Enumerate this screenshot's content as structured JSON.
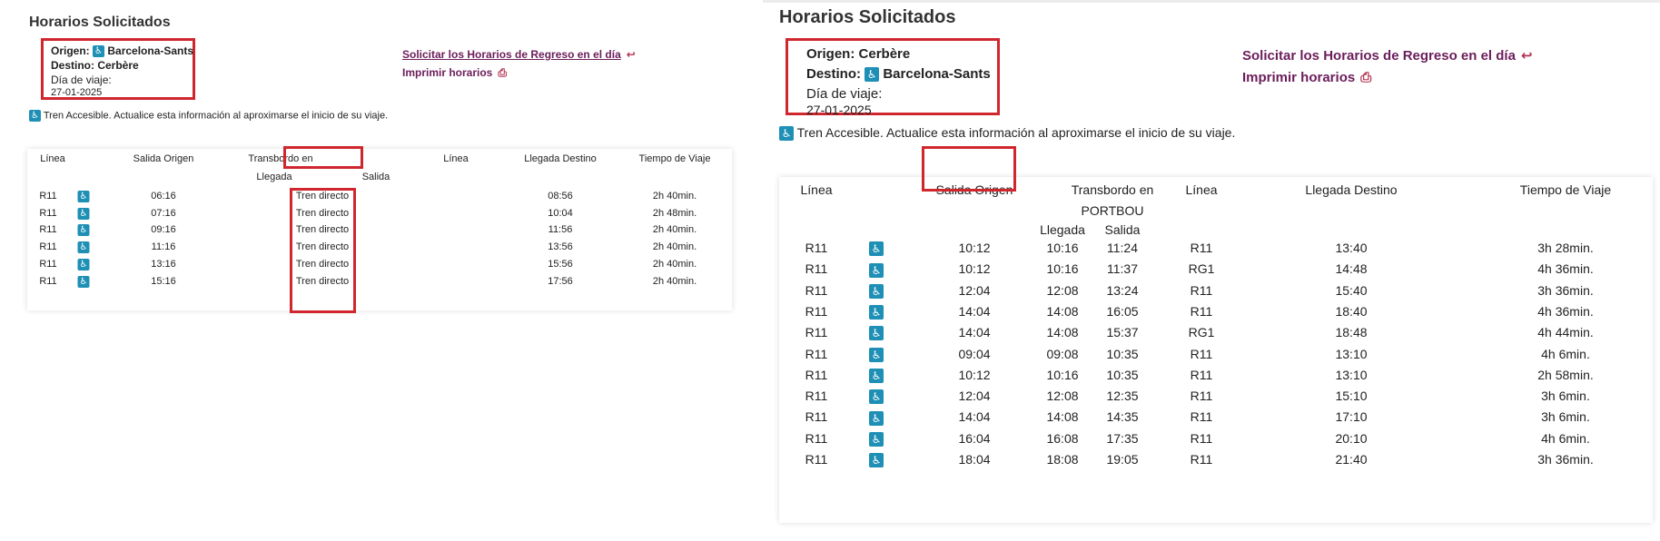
{
  "left": {
    "title": "Horarios Solicitados",
    "origen_label": "Origen:",
    "origen_value": "Barcelona-Sants",
    "destino_label": "Destino:",
    "destino_value": "Cerbère",
    "dia_label": "Día de viaje:",
    "fecha": "27-01-2025",
    "link_regreso": "Solicitar los Horarios de Regreso en el día",
    "link_imprimir": "Imprimir horarios",
    "nota_accesible": "Tren Accesible. Actualice esta información al aproximarse el inicio de su viaje.",
    "headers": {
      "linea": "Línea",
      "salida_origen": "Salida Origen",
      "transbordo": "Transbordo en",
      "llegada": "Llegada",
      "salida": "Salida",
      "linea2": "Línea",
      "llegada_destino": "Llegada Destino",
      "tiempo": "Tiempo de Viaje"
    },
    "rows": [
      {
        "linea": "R11",
        "salida": "06:16",
        "transbordo": "Tren directo",
        "llegada_destino": "08:56",
        "tiempo": "2h 40min."
      },
      {
        "linea": "R11",
        "salida": "07:16",
        "transbordo": "Tren directo",
        "llegada_destino": "10:04",
        "tiempo": "2h 48min."
      },
      {
        "linea": "R11",
        "salida": "09:16",
        "transbordo": "Tren directo",
        "llegada_destino": "11:56",
        "tiempo": "2h 40min."
      },
      {
        "linea": "R11",
        "salida": "11:16",
        "transbordo": "Tren directo",
        "llegada_destino": "13:56",
        "tiempo": "2h 40min."
      },
      {
        "linea": "R11",
        "salida": "13:16",
        "transbordo": "Tren directo",
        "llegada_destino": "15:56",
        "tiempo": "2h 40min."
      },
      {
        "linea": "R11",
        "salida": "15:16",
        "transbordo": "Tren directo",
        "llegada_destino": "17:56",
        "tiempo": "2h 40min."
      }
    ]
  },
  "right": {
    "title": "Horarios Solicitados",
    "origen_label": "Origen:",
    "origen_value": "Cerbère",
    "destino_label": "Destino:",
    "destino_value": "Barcelona-Sants",
    "dia_label": "Día de viaje:",
    "fecha": "27-01-2025",
    "link_regreso": "Solicitar los Horarios de Regreso en el día",
    "link_imprimir": "Imprimir horarios",
    "nota_accesible": "Tren Accesible. Actualice esta información al aproximarse el inicio de su viaje.",
    "headers": {
      "linea": "Línea",
      "salida_origen": "Salida Origen",
      "transbordo": "Transbordo en",
      "estacion": "PORTBOU",
      "llegada": "Llegada",
      "salida": "Salida",
      "linea2": "Línea",
      "llegada_destino": "Llegada Destino",
      "tiempo": "Tiempo de Viaje"
    },
    "rows": [
      {
        "linea": "R11",
        "salida": "10:12",
        "llegada_t": "10:16",
        "salida_t": "11:24",
        "linea2": "R11",
        "llegada_destino": "13:40",
        "tiempo": "3h 28min."
      },
      {
        "linea": "R11",
        "salida": "10:12",
        "llegada_t": "10:16",
        "salida_t": "11:37",
        "linea2": "RG1",
        "llegada_destino": "14:48",
        "tiempo": "4h 36min."
      },
      {
        "linea": "R11",
        "salida": "12:04",
        "llegada_t": "12:08",
        "salida_t": "13:24",
        "linea2": "R11",
        "llegada_destino": "15:40",
        "tiempo": "3h 36min."
      },
      {
        "linea": "R11",
        "salida": "14:04",
        "llegada_t": "14:08",
        "salida_t": "16:05",
        "linea2": "R11",
        "llegada_destino": "18:40",
        "tiempo": "4h 36min."
      },
      {
        "linea": "R11",
        "salida": "14:04",
        "llegada_t": "14:08",
        "salida_t": "15:37",
        "linea2": "RG1",
        "llegada_destino": "18:48",
        "tiempo": "4h 44min."
      },
      {
        "linea": "R11",
        "salida": "09:04",
        "llegada_t": "09:08",
        "salida_t": "10:35",
        "linea2": "R11",
        "llegada_destino": "13:10",
        "tiempo": "4h 6min."
      },
      {
        "linea": "R11",
        "salida": "10:12",
        "llegada_t": "10:16",
        "salida_t": "10:35",
        "linea2": "R11",
        "llegada_destino": "13:10",
        "tiempo": "2h 58min."
      },
      {
        "linea": "R11",
        "salida": "12:04",
        "llegada_t": "12:08",
        "salida_t": "12:35",
        "linea2": "R11",
        "llegada_destino": "15:10",
        "tiempo": "3h 6min."
      },
      {
        "linea": "R11",
        "salida": "14:04",
        "llegada_t": "14:08",
        "salida_t": "14:35",
        "linea2": "R11",
        "llegada_destino": "17:10",
        "tiempo": "3h 6min."
      },
      {
        "linea": "R11",
        "salida": "16:04",
        "llegada_t": "16:08",
        "salida_t": "17:35",
        "linea2": "R11",
        "llegada_destino": "20:10",
        "tiempo": "4h 6min."
      },
      {
        "linea": "R11",
        "salida": "18:04",
        "llegada_t": "18:08",
        "salida_t": "19:05",
        "linea2": "R11",
        "llegada_destino": "21:40",
        "tiempo": "3h 36min."
      }
    ]
  },
  "icons": {
    "accessible": "wheelchair-icon",
    "return": "return-arrow-icon",
    "print": "printer-icon"
  },
  "colors": {
    "link": "#6b1d5a",
    "accessible_badge": "#1e8fb5",
    "highlight_box": "#d0262e"
  }
}
